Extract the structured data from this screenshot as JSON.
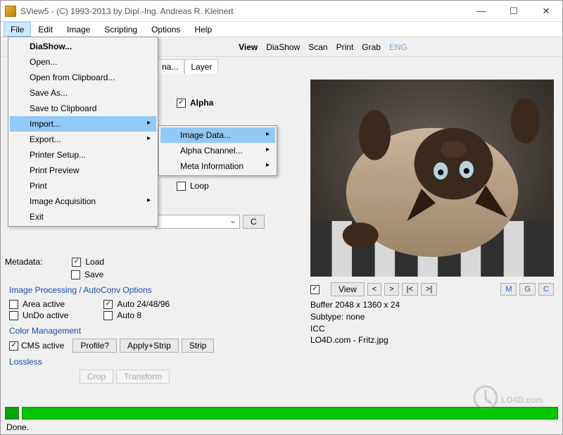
{
  "window": {
    "title": "SView5 - (C) 1993-2013 by Dipl.-Ing. Andreas R. Kleinert"
  },
  "menubar": [
    "File",
    "Edit",
    "Image",
    "Scripting",
    "Options",
    "Help"
  ],
  "toolbar": {
    "view": "View",
    "diashow": "DiaShow",
    "scan": "Scan",
    "print": "Print",
    "grab": "Grab",
    "eng": "ENG"
  },
  "tabs": {
    "t1": "na...",
    "t2": "Layer"
  },
  "file_menu": {
    "items": [
      "DiaShow...",
      "Open...",
      "Open from Clipboard...",
      "Save As...",
      "Save to Clipboard",
      "Import...",
      "Export...",
      "Printer Setup...",
      "Print Preview",
      "Print",
      "Image Acquisition",
      "Exit"
    ]
  },
  "import_submenu": {
    "items": [
      "Image Data...",
      "Alpha Channel...",
      "Meta Information"
    ]
  },
  "panel": {
    "alpha": "Alpha",
    "loop": "Loop",
    "c_btn": "C",
    "metadata_label": "Metadata:",
    "load": "Load",
    "save": "Save",
    "ip_group": "Image Processing / AutoConv Options",
    "area_active": "Area active",
    "auto24": "Auto 24/48/96",
    "undo_active": "UnDo active",
    "auto8": "Auto 8",
    "cm_group": "Color Management",
    "cms_active": "CMS active",
    "profile_btn": "Profile?",
    "applystrip_btn": "Apply+Strip",
    "strip_btn": "Strip",
    "lossless_group": "Lossless",
    "crop_btn": "Crop",
    "transform_btn": "Transform"
  },
  "info": {
    "view_btn": "View",
    "nav": [
      "<",
      ">",
      "|<",
      ">|"
    ],
    "mgc": [
      "M",
      "G",
      "C"
    ],
    "line1": "Buffer 2048 x 1360 x 24",
    "line2": "Subtype: none",
    "line3": "ICC",
    "line4": "LO4D.com - Fritz.jpg"
  },
  "status": {
    "done": "Done."
  },
  "watermark": "LO4D.com",
  "colors": {
    "accent": "#91c9f7",
    "progress": "#00c800"
  }
}
